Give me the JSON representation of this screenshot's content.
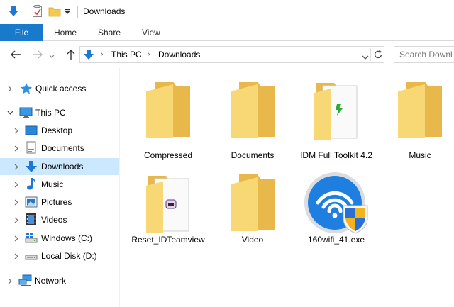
{
  "window": {
    "title": "Downloads"
  },
  "ribbon": {
    "tabs": [
      {
        "label": "File"
      },
      {
        "label": "Home"
      },
      {
        "label": "Share"
      },
      {
        "label": "View"
      }
    ]
  },
  "address": {
    "crumbs": [
      "This PC",
      "Downloads"
    ],
    "search_placeholder": "Search Downl"
  },
  "nav": {
    "items": [
      {
        "label": "Quick access",
        "icon": "star-icon"
      },
      {
        "label": "This PC",
        "icon": "monitor-icon",
        "expanded": true
      },
      {
        "label": "Desktop",
        "icon": "desktop-icon"
      },
      {
        "label": "Documents",
        "icon": "documents-icon"
      },
      {
        "label": "Downloads",
        "icon": "downloads-icon",
        "selected": true
      },
      {
        "label": "Music",
        "icon": "music-icon"
      },
      {
        "label": "Pictures",
        "icon": "pictures-icon"
      },
      {
        "label": "Videos",
        "icon": "videos-icon"
      },
      {
        "label": "Windows (C:)",
        "icon": "drive-windows-icon"
      },
      {
        "label": "Local Disk (D:)",
        "icon": "drive-icon"
      },
      {
        "label": "Network",
        "icon": "network-icon"
      }
    ]
  },
  "files": [
    {
      "name": "Compressed",
      "type": "folder"
    },
    {
      "name": "Documents",
      "type": "folder"
    },
    {
      "name": "IDM Full Toolkit 4.2",
      "type": "folder-with-file"
    },
    {
      "name": "Music",
      "type": "folder"
    },
    {
      "name": "Reset_IDTeamview",
      "type": "folder-with-file"
    },
    {
      "name": "Video",
      "type": "folder"
    },
    {
      "name": "160wifi_41.exe",
      "type": "exe"
    }
  ],
  "colors": {
    "accent": "#1979ca",
    "selection": "#cce8ff",
    "folder_front": "#f8d775",
    "folder_back": "#e8b94a"
  }
}
